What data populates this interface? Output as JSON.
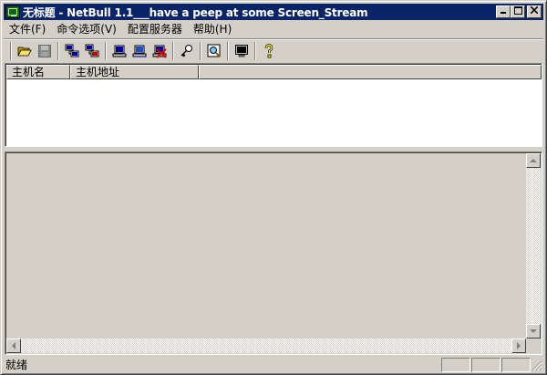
{
  "window": {
    "title": "无标题 - NetBull 1.1___have a peep at some Screen_Stream",
    "controls": {
      "minimize": "0",
      "maximize": "1",
      "close": "r"
    }
  },
  "menu": {
    "items": [
      {
        "label": "文件(F)"
      },
      {
        "label": "命令选项(V)"
      },
      {
        "label": "配置服务器"
      },
      {
        "label": "帮助(H)"
      }
    ]
  },
  "toolbar": {
    "buttons": [
      {
        "icon": "open-folder-icon"
      },
      {
        "icon": "save-disk-icon"
      },
      {
        "icon": "connect-host-icon"
      },
      {
        "icon": "disconnect-host-icon"
      },
      {
        "icon": "computer-icon"
      },
      {
        "icon": "computer-network-icon"
      },
      {
        "icon": "computer-delete-icon"
      },
      {
        "icon": "key-icon"
      },
      {
        "icon": "zoom-view-icon"
      },
      {
        "icon": "monitor-icon"
      },
      {
        "icon": "help-icon"
      }
    ]
  },
  "hostlist": {
    "columns": [
      {
        "label": "主机名"
      },
      {
        "label": "主机地址"
      }
    ],
    "rows": []
  },
  "statusbar": {
    "text": "就绪"
  },
  "colors": {
    "titlebar": "#0a246a",
    "face": "#d4d0c8"
  }
}
